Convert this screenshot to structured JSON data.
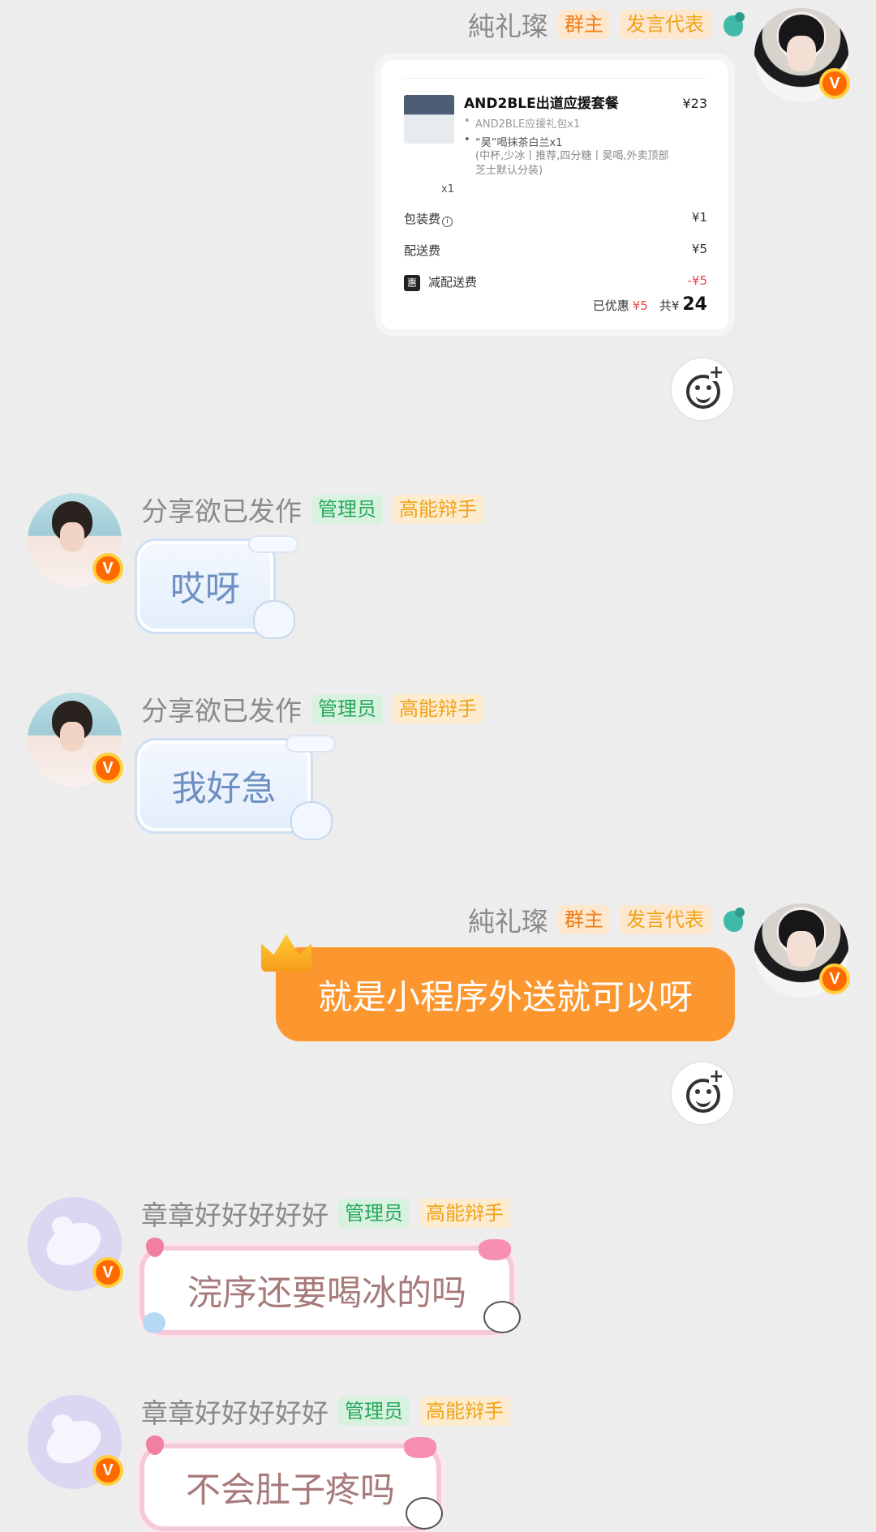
{
  "messages": [
    {
      "sender": "純礼璨",
      "tags": [
        "群主",
        "发言代表"
      ],
      "type": "order_card",
      "order": {
        "title": "AND2BLE出道应援套餐",
        "price": "¥23",
        "items": [
          "AND2BLE应援礼包x1",
          "“昊”喝抹茶白兰x1"
        ],
        "note_line1": "(中杯,少冰丨推荐,四分糖丨昊喝,外卖顶部",
        "note_line2": "芝士默认分装)",
        "qty": "x1",
        "fees": [
          {
            "label": "包装费",
            "value": "¥1"
          },
          {
            "label": "配送费",
            "value": "¥5"
          },
          {
            "label": "减配送费",
            "value": "-¥5"
          }
        ],
        "discount_badge": "惠",
        "saved_label": "已优惠",
        "saved_value": "¥5",
        "total_label": "共¥",
        "total_value": "24"
      }
    },
    {
      "sender": "分享欲已发作",
      "tags": [
        "管理员",
        "高能辩手"
      ],
      "text": "哎呀"
    },
    {
      "sender": "分享欲已发作",
      "tags": [
        "管理员",
        "高能辩手"
      ],
      "text": "我好急"
    },
    {
      "sender": "純礼璨",
      "tags": [
        "群主",
        "发言代表"
      ],
      "text": "就是小程序外送就可以呀"
    },
    {
      "sender": "章章好好好好好",
      "tags": [
        "管理员",
        "高能辩手"
      ],
      "text": "浣序还要喝冰的吗"
    },
    {
      "sender": "章章好好好好好",
      "tags": [
        "管理员",
        "高能辩手"
      ],
      "text": "不会肚子疼吗"
    }
  ],
  "badge_letter": "V",
  "icons": {
    "react": "add-emoji-reaction-icon",
    "bird": "parrot-icon",
    "crown": "crown-icon"
  }
}
